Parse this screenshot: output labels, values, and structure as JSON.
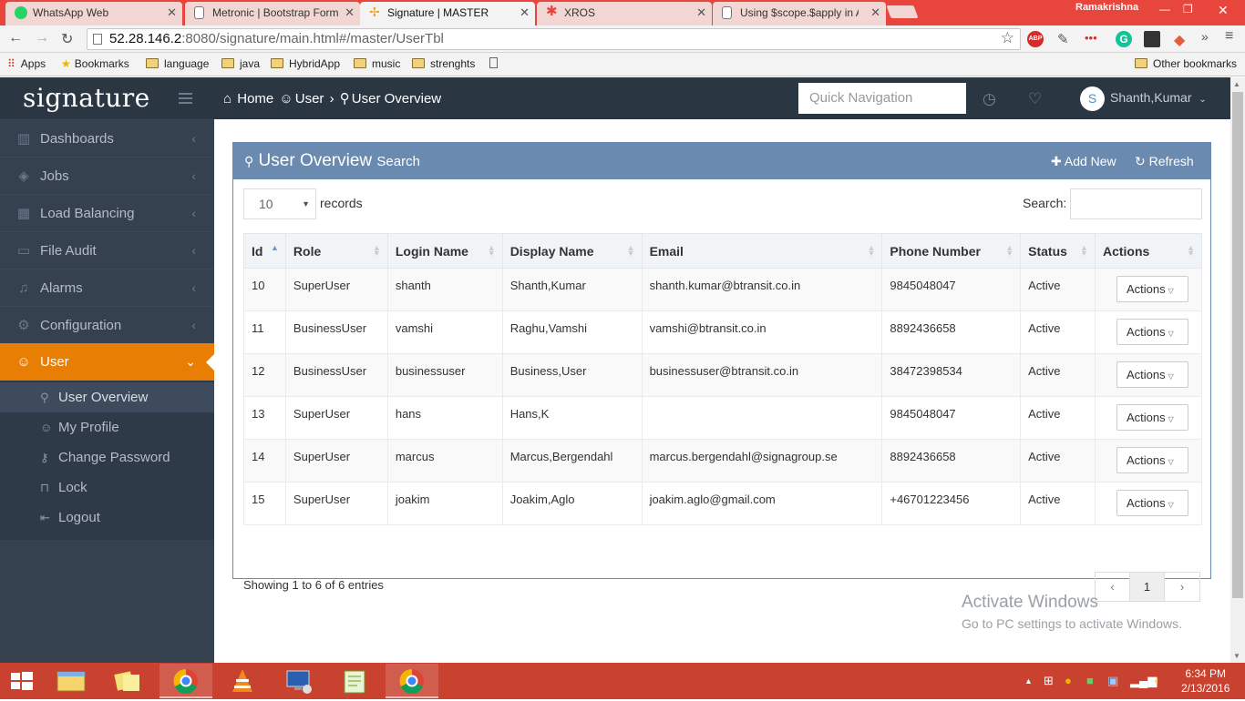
{
  "browser": {
    "tabs": [
      {
        "title": "WhatsApp Web",
        "icon": "whatsapp-icon",
        "color": "#25d366"
      },
      {
        "title": "Metronic | Bootstrap Form",
        "icon": "page-icon",
        "color": "#ffffff"
      },
      {
        "title": "Signature | MASTER",
        "icon": "signature-icon",
        "color": "#f0a020"
      },
      {
        "title": "XROS",
        "icon": "xros-icon",
        "color": "#e8453c"
      },
      {
        "title": "Using $scope.$apply in An",
        "icon": "page-icon",
        "color": "#ffffff"
      }
    ],
    "profile_name": "Ramakrishna",
    "url_host": "52.28.146.2",
    "url_rest": ":8080/signature/main.html#/master/UserTbl",
    "bookmarks": [
      "Apps",
      "Bookmarks",
      "language",
      "java",
      "HybridApp",
      "music",
      "strenghts"
    ],
    "other_bookmarks": "Other bookmarks"
  },
  "app": {
    "brand": "signature",
    "breadcrumb": [
      "Home",
      "User",
      "User Overview"
    ],
    "quick_nav_placeholder": "Quick Navigation",
    "user_initial": "S",
    "user_name": "Shanth,Kumar",
    "menu": [
      {
        "label": "Dashboards",
        "icon": "chart-icon"
      },
      {
        "label": "Jobs",
        "icon": "layers-icon"
      },
      {
        "label": "Load Balancing",
        "icon": "grid-icon"
      },
      {
        "label": "File Audit",
        "icon": "folder-icon"
      },
      {
        "label": "Alarms",
        "icon": "bell-icon"
      },
      {
        "label": "Configuration",
        "icon": "gear-icon"
      },
      {
        "label": "User",
        "icon": "user-icon"
      }
    ],
    "submenu": [
      "User Overview",
      "My Profile",
      "Change Password",
      "Lock",
      "Logout"
    ]
  },
  "portlet": {
    "title": "User Overview",
    "subtitle": "Search",
    "add_new": "Add New",
    "refresh": "Refresh",
    "length_value": "10",
    "records_label": "records",
    "search_label": "Search:",
    "columns": [
      "Id",
      "Role",
      "Login Name",
      "Display Name",
      "Email",
      "Phone Number",
      "Status",
      "Actions"
    ],
    "rows": [
      {
        "id": "10",
        "role": "SuperUser",
        "login": "shanth",
        "display": "Shanth,Kumar",
        "email": "shanth.kumar@btransit.co.in",
        "phone": "9845048047",
        "status": "Active"
      },
      {
        "id": "11",
        "role": "BusinessUser",
        "login": "vamshi",
        "display": "Raghu,Vamshi",
        "email": "vamshi@btransit.co.in",
        "phone": "8892436658",
        "status": "Active"
      },
      {
        "id": "12",
        "role": "BusinessUser",
        "login": "businessuser",
        "display": "Business,User",
        "email": "businessuser@btransit.co.in",
        "phone": "38472398534",
        "status": "Active"
      },
      {
        "id": "13",
        "role": "SuperUser",
        "login": "hans",
        "display": "Hans,K",
        "email": "",
        "phone": "9845048047",
        "status": "Active"
      },
      {
        "id": "14",
        "role": "SuperUser",
        "login": "marcus",
        "display": "Marcus,Bergendahl",
        "email": "marcus.bergendahl@signagroup.se",
        "phone": "8892436658",
        "status": "Active"
      },
      {
        "id": "15",
        "role": "SuperUser",
        "login": "joakim",
        "display": "Joakim,Aglo",
        "email": "joakim.aglo@gmail.com",
        "phone": "+46701223456",
        "status": "Active"
      }
    ],
    "actions_label": "Actions",
    "info": "Showing 1 to 6 of 6 entries",
    "page": "1"
  },
  "watermark": {
    "line1": "Activate Windows",
    "line2": "Go to PC settings to activate Windows."
  },
  "taskbar": {
    "time": "6:34 PM",
    "date": "2/13/2016"
  },
  "colors": {
    "accent": "#e87e04",
    "sidebar": "#364150",
    "header": "#2b3643",
    "portlet": "#6b8aaf",
    "taskbar": "#c9412f"
  }
}
